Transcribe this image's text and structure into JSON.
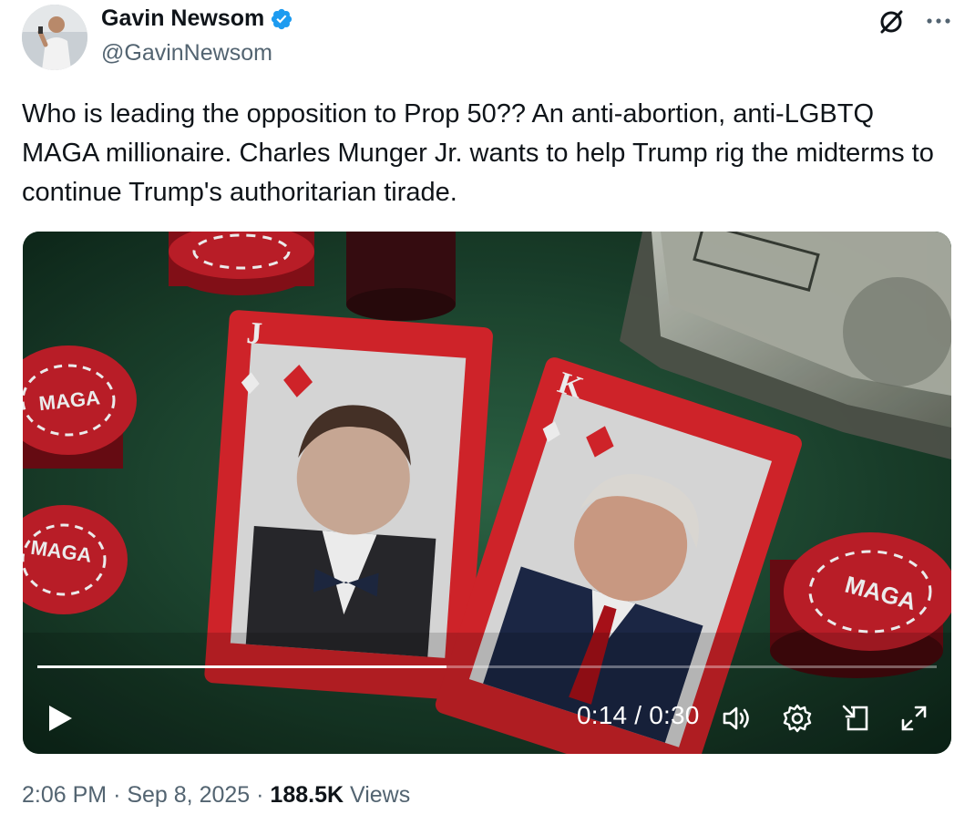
{
  "author": {
    "display_name": "Gavin Newsom",
    "handle": "@GavinNewsom",
    "verified": true
  },
  "header_icons": [
    "grok-icon",
    "more-icon"
  ],
  "tweet": {
    "text": "Who is leading the opposition to Prop 50?? An anti-abortion, anti-LGBTQ MAGA millionaire. Charles Munger Jr. wants to help Trump rig the midterms to continue Trump's authoritarian tirade."
  },
  "media": {
    "type": "video",
    "chip_labels": [
      "MAGA",
      "MAGA",
      "MAGA"
    ],
    "card_ranks": [
      "J",
      "K"
    ],
    "player": {
      "current_time": "0:14",
      "separator": "/",
      "duration": "0:30",
      "progress": 0.455,
      "controls": [
        "play-icon",
        "volume-icon",
        "settings-gear-icon",
        "picture-in-picture-icon",
        "fullscreen-icon"
      ]
    }
  },
  "meta": {
    "time": "2:06 PM",
    "date": "Sep 8, 2025",
    "views_count": "188.5K",
    "views_label": "Views",
    "dot": "·"
  },
  "colors": {
    "verified_blue": "#1d9bf0",
    "secondary_text": "#536471",
    "primary_text": "#0f1419",
    "felt_green": "#1f4a33",
    "chip_red": "#c8202b",
    "card_red": "#e0262d"
  }
}
